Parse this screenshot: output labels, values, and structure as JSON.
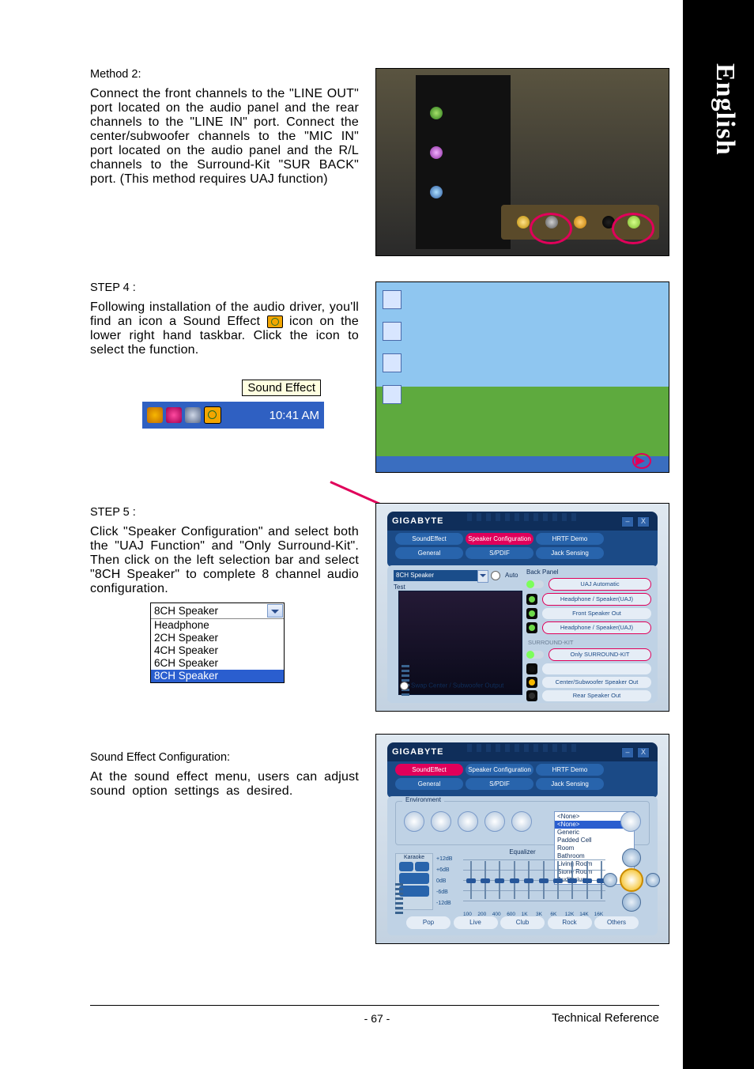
{
  "tab_label": "English",
  "method2_title": "Method 2:",
  "method2_text": "Connect the front channels to the \"LINE OUT\" port located on the audio panel and the rear channels to the \"LINE IN\" port. Connect the center/subwoofer channels to the \"MIC IN\" port located on the audio panel and the R/L channels to the Surround-Kit \"SUR BACK\" port.  (This method requires UAJ function)",
  "step4_title": "STEP 4 :",
  "step4_text_a": "Following installation of the audio driver, you'll find an icon a Sound Effect ",
  "step4_text_b": " icon on the lower right hand taskbar.  Click the icon to select the function.",
  "tray_tooltip": "Sound Effect",
  "tray_time": "10:41 AM",
  "step5_title": "STEP 5 :",
  "step5_text": "Click \"Speaker Configuration\" and select both the \"UAJ Function\" and \"Only Surround-Kit\".  Then click on the left selection bar and select \"8CH Speaker\" to complete 8 channel audio configuration.",
  "dropdown": {
    "selected": "8CH Speaker",
    "options": [
      "Headphone",
      "2CH Speaker",
      "4CH Speaker",
      "6CH Speaker",
      "8CH Speaker"
    ],
    "highlighted_index": 4
  },
  "sfx_title": "Sound Effect Configuration:",
  "sfx_text": "At the sound effect menu, users can adjust sound option settings as desired.",
  "app": {
    "logo": "GIGABYTE",
    "wm_min": "–",
    "wm_close": "X",
    "tabs": [
      "SoundEffect",
      "Speaker Configuration",
      "HRTF Demo",
      "General",
      "S/PDIF",
      "Jack Sensing"
    ],
    "speaker_mode_sel": "8CH Speaker",
    "auto_test": "Auto Test",
    "swap": "Swap Center / Subwoofer Output",
    "back_panel": "Back Panel",
    "uaj_automatic": "UAJ Automatic",
    "jacks": [
      {
        "color": "#6eda4a",
        "label": "Headphone / Speaker(UAJ)",
        "red": true
      },
      {
        "color": "#6eda4a",
        "label": "Front Speaker Out",
        "red": false
      },
      {
        "color": "#6eda4a",
        "label": "Headphone / Speaker(UAJ)",
        "red": true
      }
    ],
    "surround_kit_label": "SURROUND-KIT",
    "only_surround": "Only SURROUND-KIT",
    "jacks2": [
      {
        "color": "#111",
        "label": "",
        "red": false
      },
      {
        "color": "#f5b800",
        "label": "Center/Subwoofer Speaker Out",
        "red": false
      },
      {
        "color": "#2e2e2e",
        "label": "Rear Speaker Out",
        "red": false
      }
    ]
  },
  "sfxwin": {
    "env_title": "Environment",
    "env_selected": "<None>",
    "env_options": [
      "<None>",
      "Generic",
      "Padded Cell",
      "Room",
      "Bathroom",
      "Living Room",
      "Stone Room",
      "Auditorium"
    ],
    "env_highlight_index": 0,
    "eq_title": "Equalizer",
    "karaoke": "Karaoke",
    "y_labels": [
      "+12dB",
      "+6dB",
      "0dB",
      "-6dB",
      "-12dB"
    ],
    "x_labels": [
      "100",
      "200",
      "400",
      "600",
      "1K",
      "3K",
      "6K",
      "12K",
      "14K",
      "16K"
    ],
    "presets": [
      "Pop",
      "Live",
      "Club",
      "Rock",
      "Others"
    ]
  },
  "footer": {
    "page": "- 67 -",
    "title": "Technical Reference"
  }
}
